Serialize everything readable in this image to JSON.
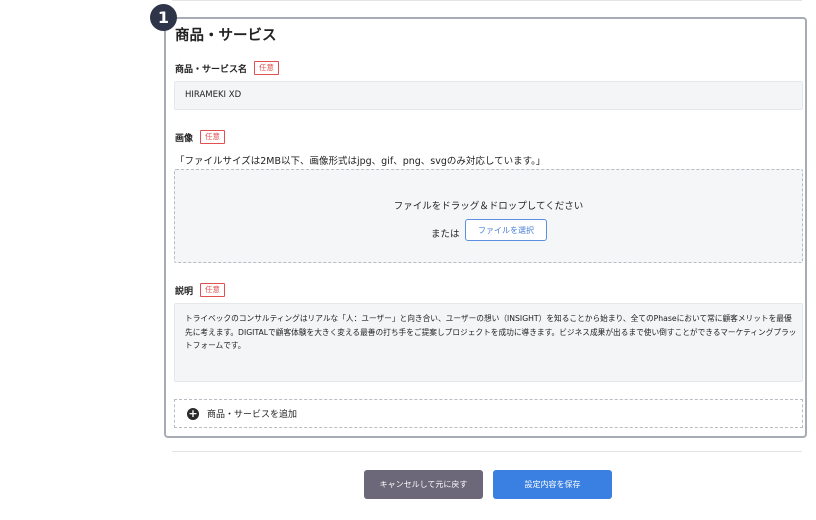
{
  "step_badge": "1",
  "section": {
    "title": "商品・サービス",
    "optional_badge": "任意",
    "name_field": {
      "label": "商品・サービス名",
      "value": "HIRAMEKI XD"
    },
    "image_field": {
      "label": "画像",
      "note": "「ファイルサイズは2MB以下、画像形式はjpg、gif、png、svgのみ対応しています。」",
      "dropzone_prompt": "ファイルをドラッグ＆ドロップしてください",
      "or_text": "または",
      "select_button": "ファイルを選択"
    },
    "description_field": {
      "label": "説明",
      "value": "トライベックのコンサルティングはリアルな「人：ユーザー」と向き合い、ユーザーの想い（INSIGHT）を知ることから始まり、全てのPhaseにおいて常に顧客メリットを最優先に考えます。DIGITALで顧客体験を大きく変える最善の打ち手をご提案しプロジェクトを成功に導きます。ビジネス成果が出るまで使い倒すことができるマーケティングプラットフォームです。"
    },
    "add_button": {
      "icon": "plus-circle-icon",
      "label": "商品・サービスを追加"
    }
  },
  "footer": {
    "cancel_label": "キャンセルして元に戻す",
    "save_label": "設定内容を保存"
  },
  "colors": {
    "badge_bg": "#2f3549",
    "optional_red": "#e05050",
    "cancel_bg": "#6c6779",
    "save_bg": "#3a7fe2",
    "link_blue": "#4a7fd4"
  }
}
